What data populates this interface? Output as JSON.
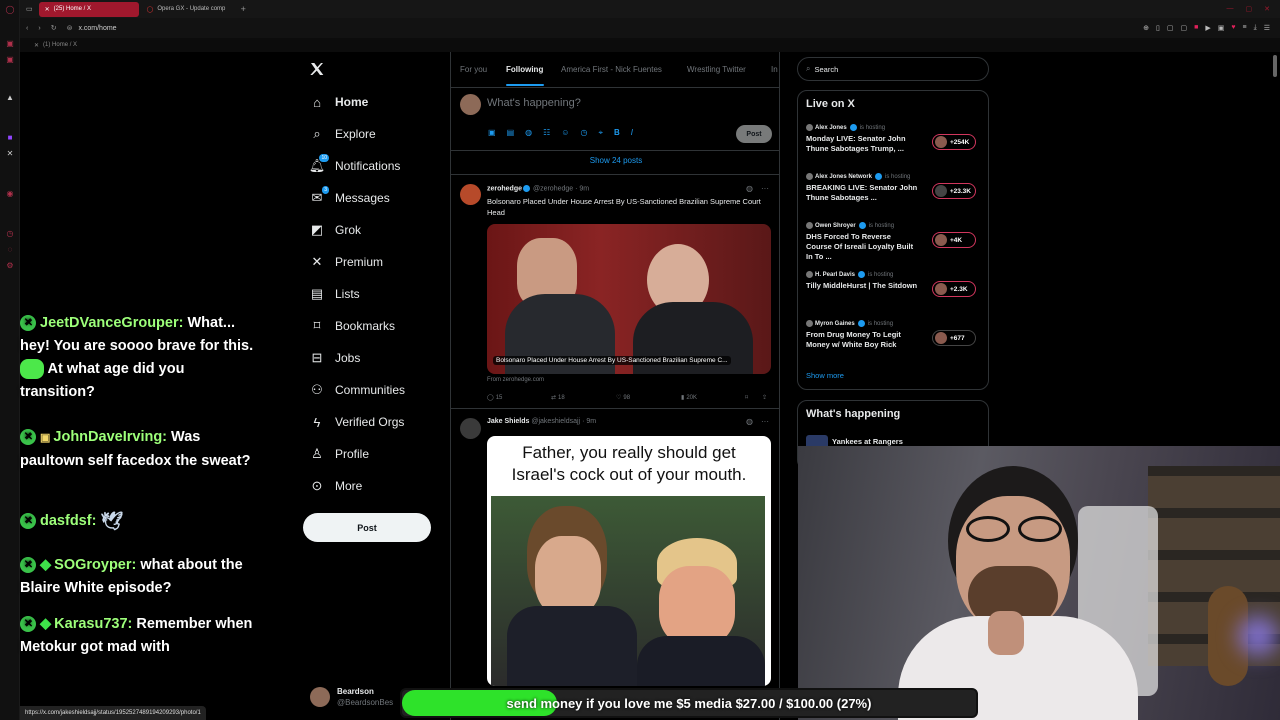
{
  "browser": {
    "tabs": [
      {
        "label": "(25) Home / X",
        "active": true
      },
      {
        "label": "Opera GX - Update comp",
        "active": false
      }
    ],
    "url": "x.com/home",
    "bookmark": "(1) Home / X",
    "status_url": "https://x.com/jakeshieldsajj/status/1952527489194209293/photo/1"
  },
  "nav": {
    "items": [
      {
        "label": "Home",
        "icon": "home-icon"
      },
      {
        "label": "Explore",
        "icon": "search-icon"
      },
      {
        "label": "Notifications",
        "icon": "bell-icon",
        "badge": "10"
      },
      {
        "label": "Messages",
        "icon": "mail-icon",
        "badge": "3"
      },
      {
        "label": "Grok",
        "icon": "grok-icon"
      },
      {
        "label": "Premium",
        "icon": "x-logo-icon"
      },
      {
        "label": "Lists",
        "icon": "list-icon"
      },
      {
        "label": "Bookmarks",
        "icon": "bookmark-icon"
      },
      {
        "label": "Jobs",
        "icon": "briefcase-icon"
      },
      {
        "label": "Communities",
        "icon": "people-icon"
      },
      {
        "label": "Verified Orgs",
        "icon": "lightning-icon"
      },
      {
        "label": "Profile",
        "icon": "person-icon"
      },
      {
        "label": "More",
        "icon": "more-circle-icon"
      }
    ],
    "post_button": "Post",
    "account_name": "Beardson",
    "account_handle": "@BeardsonBes"
  },
  "feed": {
    "tabs": [
      "For you",
      "Following",
      "America First - Nick Fuentes",
      "Wrestling Twitter",
      "In"
    ],
    "active_tab": "Following",
    "compose_placeholder": "What's happening?",
    "compose_post": "Post",
    "show_posts": "Show 24 posts",
    "posts": [
      {
        "name": "zerohedge",
        "handle": "@zerohedge",
        "time": "· 9m",
        "text": "Bolsonaro Placed Under House Arrest By US-Sanctioned Brazilian Supreme Court Head",
        "card_caption": "Bolsonaro Placed Under House Arrest By US-Sanctioned Brazilian Supreme C...",
        "card_source": "From zerohedge.com",
        "replies": "15",
        "reposts": "18",
        "likes": "98",
        "views": "20K"
      },
      {
        "name": "Jake Shields",
        "handle": "@jakeshieldsajj",
        "time": "· 9m",
        "meme_text": "Father, you really should get Israel's cock out of your mouth."
      }
    ]
  },
  "right": {
    "search_placeholder": "Search",
    "live_title": "Live on X",
    "hosting_label": "is hosting",
    "live": [
      {
        "host": "Alex Jones",
        "title": "Monday LIVE: Senator John Thune Sabotages Trump, ...",
        "count": "+254K"
      },
      {
        "host": "Alex Jones Network",
        "title": "BREAKING LIVE: Senator John Thune Sabotages ...",
        "count": "+23.3K"
      },
      {
        "host": "Owen Shroyer",
        "title": "DHS Forced To Reverse Course Of Isreali Loyalty Built In To ...",
        "count": "+4K"
      },
      {
        "host": "H. Pearl Davis",
        "title": "Tilly MiddleHurst | The Sitdown",
        "count": "+2.3K"
      },
      {
        "host": "Myron Gaines",
        "title": "From Drug Money To Legit Money w/ White Boy Rick",
        "count": "+677"
      }
    ],
    "show_more": "Show more",
    "happening_title": "What's happening",
    "happening_item": "Yankees at Rangers"
  },
  "chat": [
    {
      "user": "JeetDVanceGrouper:",
      "message": "What... hey! You are soooo brave for this.",
      "message2": "At what age did you transition?",
      "emote": true
    },
    {
      "user": "JohnDaveIrving:",
      "message": "Was paultown self facedox the sweat?",
      "badge": true
    },
    {
      "user": "dasfdsf:",
      "message": "",
      "bird": true
    },
    {
      "user": "SOGroyper:",
      "message": "what about the Blaire White episode?",
      "diamond": true
    },
    {
      "user": "Karasu737:",
      "message": "Remember when Metokur got mad with",
      "diamond": true
    }
  ],
  "donation": {
    "text": "send money if you love me $5 media $27.00 / $100.00 (27%)",
    "progress": 0.27
  },
  "colors": {
    "accent": "#1d9bf0",
    "opera_red": "#a0182d",
    "chat_user": "#9dff7a",
    "donation_green": "#2ee22a"
  }
}
